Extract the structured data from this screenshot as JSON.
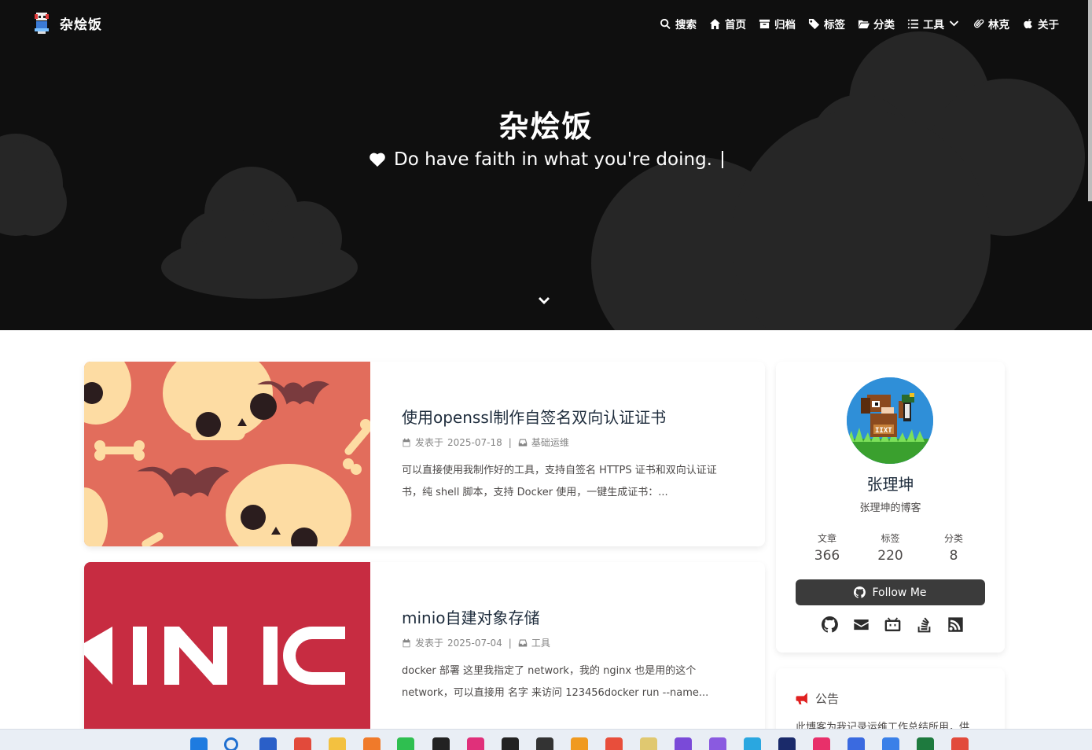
{
  "site": {
    "logo_text": "杂烩饭",
    "title": "杂烩饭",
    "subtitle": "Do have faith in what you're doing."
  },
  "nav": {
    "items": [
      {
        "label": "搜索",
        "icon": "search-icon"
      },
      {
        "label": "首页",
        "icon": "home-icon"
      },
      {
        "label": "归档",
        "icon": "archive-icon"
      },
      {
        "label": "标签",
        "icon": "tags-icon"
      },
      {
        "label": "分类",
        "icon": "folder-open-icon"
      },
      {
        "label": "工具",
        "icon": "list-icon"
      },
      {
        "label": "林克",
        "icon": "link-icon"
      },
      {
        "label": "关于",
        "icon": "apple-icon"
      }
    ]
  },
  "posts": [
    {
      "title": "使用openssl制作自签名双向认证证书",
      "date_prefix": "发表于",
      "date": "2025-07-18",
      "category": "基础运维",
      "excerpt": "可以直接使用我制作好的工具，支持自签名 HTTPS 证书和双向认证证书，纯 shell 脚本，支持 Docker 使用，一键生成证书：..."
    },
    {
      "title": "minio自建对象存储",
      "date_prefix": "发表于",
      "date": "2025-07-04",
      "category": "工具",
      "excerpt": "docker 部署 这里我指定了 network，我的 nginx 也是用的这个 network，可以直接用 名字 来访问 123456docker run --name..."
    }
  ],
  "author": {
    "name": "张理坤",
    "description": "张理坤的博客",
    "stats": [
      {
        "label": "文章",
        "value": "366"
      },
      {
        "label": "标签",
        "value": "220"
      },
      {
        "label": "分类",
        "value": "8"
      }
    ],
    "follow_label": "Follow Me",
    "socials": [
      "github-icon",
      "mail-icon",
      "bilibili-icon",
      "stackoverflow-icon",
      "rss-icon"
    ]
  },
  "notice": {
    "title": "公告",
    "text": "此博客为我记录运维工作总结所用，供"
  },
  "colors": {
    "hero_bg": "#0f0f0f",
    "cloud": "#262626",
    "cover1_bg": "#e26d5c",
    "cover2_bg": "#c72c41",
    "follow_btn": "#3b3b3b",
    "notice_icon": "#e02020"
  }
}
